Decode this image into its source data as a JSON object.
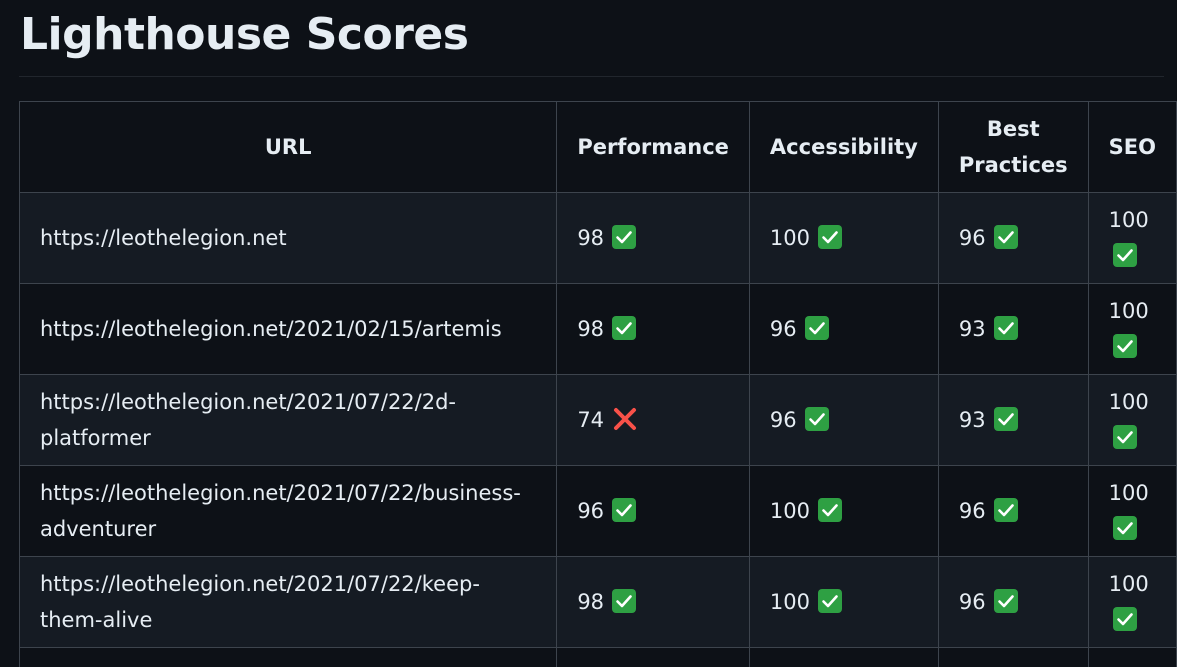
{
  "title": "Lighthouse Scores",
  "table": {
    "headers": {
      "url": "URL",
      "performance": "Performance",
      "accessibility": "Accessibility",
      "best_practices": "Best Practices",
      "seo": "SEO"
    },
    "rows": [
      {
        "url": "https://leothelegion.net",
        "performance": "98",
        "performance_status": "pass",
        "accessibility": "100",
        "accessibility_status": "pass",
        "best_practices": "96",
        "best_practices_status": "pass",
        "seo": "100",
        "seo_status": "pass"
      },
      {
        "url": "https://leothelegion.net/2021/02/15/artemis",
        "performance": "98",
        "performance_status": "pass",
        "accessibility": "96",
        "accessibility_status": "pass",
        "best_practices": "93",
        "best_practices_status": "pass",
        "seo": "100",
        "seo_status": "pass"
      },
      {
        "url": "https://leothelegion.net/2021/07/22/2d-platformer",
        "performance": "74",
        "performance_status": "fail",
        "accessibility": "96",
        "accessibility_status": "pass",
        "best_practices": "93",
        "best_practices_status": "pass",
        "seo": "100",
        "seo_status": "pass"
      },
      {
        "url": "https://leothelegion.net/2021/07/22/business-adventurer",
        "performance": "96",
        "performance_status": "pass",
        "accessibility": "100",
        "accessibility_status": "pass",
        "best_practices": "96",
        "best_practices_status": "pass",
        "seo": "100",
        "seo_status": "pass"
      },
      {
        "url": "https://leothelegion.net/2021/07/22/keep-them-alive",
        "performance": "98",
        "performance_status": "pass",
        "accessibility": "100",
        "accessibility_status": "pass",
        "best_practices": "96",
        "best_practices_status": "pass",
        "seo": "100",
        "seo_status": "pass"
      }
    ]
  },
  "icons": {
    "pass": "check-mark-icon",
    "fail": "cross-mark-icon"
  },
  "colors": {
    "background": "#0d1117",
    "row_alt": "#151b23",
    "border": "#3d444d",
    "pass": "#2ea043",
    "fail": "#f85149"
  }
}
